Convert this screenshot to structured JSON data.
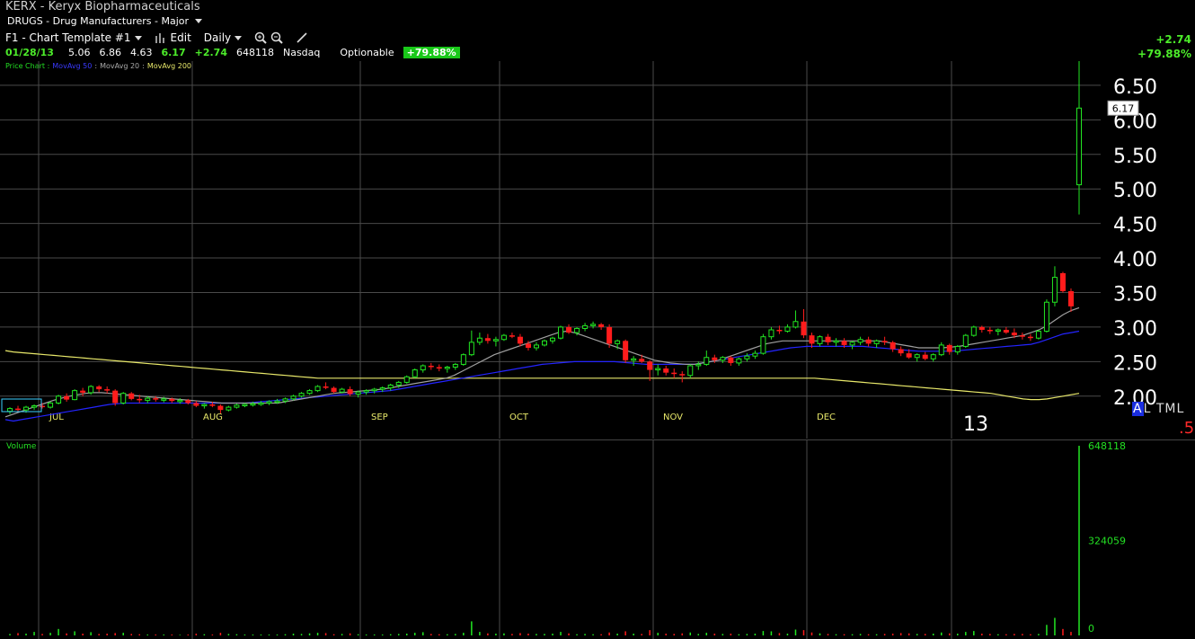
{
  "header": {
    "title": "KERX - Keryx Biopharmaceuticals",
    "industry": "DRUGS - Drug Manufacturers - Major"
  },
  "toolbar": {
    "template": "F1 - Chart Template #1",
    "edit": "Edit",
    "interval": "Daily"
  },
  "quote": {
    "date": "01/28/13",
    "open": "5.06",
    "high": "6.86",
    "low": "4.63",
    "close": "6.17",
    "change": "+2.74",
    "volume": "648118",
    "exchange": "Nasdaq",
    "optionable": "Optionable",
    "pct_change": "+79.88%"
  },
  "right_info": {
    "change": "+2.74",
    "pct": "+79.88%"
  },
  "legend": {
    "price": "Price Chart :",
    "ma50": "MovAvg 50",
    "ma20": "MovAvg 20",
    "ma200": "MovAvg 200",
    "sep": ":"
  },
  "last_price_tag": "6.17",
  "year_label": "13",
  "scale_modes": {
    "a": "A",
    "l": "L",
    "t": "T",
    "m": "M",
    "l2": "L"
  },
  "scale_fraction": ".5",
  "volume_panel": {
    "label": "Volume",
    "ticks": [
      "648118",
      "324059",
      "0"
    ]
  },
  "colors": {
    "up": "#22e622",
    "down": "#ff1c1c",
    "ma50": "#2424ff",
    "ma20": "#a0a0a0",
    "ma200": "#e8e86a",
    "grid": "#4a4a4a"
  },
  "chart_data": {
    "type": "candlestick",
    "ylim": [
      1.75,
      6.85
    ],
    "y_ticks": [
      "6.50",
      "6.00",
      "5.50",
      "5.00",
      "4.50",
      "4.00",
      "3.50",
      "3.00",
      "2.50",
      "2.00"
    ],
    "month_labels": [
      "JUL",
      "AUG",
      "SEP",
      "OCT",
      "NOV",
      "DEC"
    ],
    "candles": [
      [
        1.78,
        1.84,
        1.74,
        1.82
      ],
      [
        1.82,
        1.86,
        1.78,
        1.8
      ],
      [
        1.8,
        1.86,
        1.76,
        1.84
      ],
      [
        1.84,
        1.88,
        1.8,
        1.86
      ],
      [
        1.86,
        1.9,
        1.82,
        1.84
      ],
      [
        1.84,
        1.92,
        1.82,
        1.9
      ],
      [
        1.9,
        2.02,
        1.88,
        2.0
      ],
      [
        2.0,
        2.04,
        1.92,
        1.95
      ],
      [
        1.95,
        2.1,
        1.94,
        2.08
      ],
      [
        2.08,
        2.12,
        2.0,
        2.05
      ],
      [
        2.05,
        2.16,
        2.02,
        2.14
      ],
      [
        2.14,
        2.16,
        2.06,
        2.1
      ],
      [
        2.1,
        2.14,
        2.04,
        2.08
      ],
      [
        2.08,
        2.1,
        1.86,
        1.9
      ],
      [
        1.9,
        2.06,
        1.88,
        2.04
      ],
      [
        2.04,
        2.06,
        1.94,
        1.96
      ],
      [
        1.96,
        2.02,
        1.9,
        1.94
      ],
      [
        1.94,
        2.0,
        1.9,
        1.97
      ],
      [
        1.97,
        2.0,
        1.92,
        1.95
      ],
      [
        1.95,
        1.99,
        1.91,
        1.96
      ],
      [
        1.96,
        1.98,
        1.9,
        1.93
      ],
      [
        1.93,
        1.97,
        1.89,
        1.94
      ],
      [
        1.94,
        1.96,
        1.88,
        1.9
      ],
      [
        1.9,
        1.93,
        1.84,
        1.86
      ],
      [
        1.86,
        1.9,
        1.82,
        1.88
      ],
      [
        1.88,
        1.92,
        1.84,
        1.86
      ],
      [
        1.86,
        1.88,
        1.75,
        1.8
      ],
      [
        1.8,
        1.86,
        1.78,
        1.84
      ],
      [
        1.84,
        1.89,
        1.82,
        1.87
      ],
      [
        1.87,
        1.9,
        1.84,
        1.88
      ],
      [
        1.88,
        1.92,
        1.85,
        1.89
      ],
      [
        1.89,
        1.93,
        1.86,
        1.9
      ],
      [
        1.9,
        1.94,
        1.87,
        1.92
      ],
      [
        1.92,
        1.96,
        1.89,
        1.93
      ],
      [
        1.93,
        1.98,
        1.9,
        1.96
      ],
      [
        1.96,
        2.02,
        1.94,
        2.0
      ],
      [
        2.0,
        2.06,
        1.98,
        2.04
      ],
      [
        2.04,
        2.1,
        2.02,
        2.08
      ],
      [
        2.08,
        2.16,
        2.06,
        2.14
      ],
      [
        2.14,
        2.2,
        2.1,
        2.12
      ],
      [
        2.12,
        2.14,
        2.04,
        2.06
      ],
      [
        2.06,
        2.12,
        2.04,
        2.1
      ],
      [
        2.1,
        2.14,
        2.0,
        2.03
      ],
      [
        2.03,
        2.08,
        1.98,
        2.06
      ],
      [
        2.06,
        2.1,
        2.02,
        2.08
      ],
      [
        2.08,
        2.12,
        2.04,
        2.1
      ],
      [
        2.1,
        2.14,
        2.06,
        2.12
      ],
      [
        2.12,
        2.18,
        2.08,
        2.16
      ],
      [
        2.16,
        2.22,
        2.12,
        2.2
      ],
      [
        2.2,
        2.3,
        2.18,
        2.28
      ],
      [
        2.28,
        2.4,
        2.26,
        2.38
      ],
      [
        2.38,
        2.46,
        2.34,
        2.44
      ],
      [
        2.44,
        2.48,
        2.38,
        2.42
      ],
      [
        2.42,
        2.46,
        2.36,
        2.4
      ],
      [
        2.4,
        2.44,
        2.34,
        2.42
      ],
      [
        2.42,
        2.48,
        2.38,
        2.46
      ],
      [
        2.46,
        2.62,
        2.44,
        2.6
      ],
      [
        2.6,
        2.95,
        2.58,
        2.78
      ],
      [
        2.78,
        2.92,
        2.74,
        2.84
      ],
      [
        2.84,
        2.9,
        2.76,
        2.8
      ],
      [
        2.8,
        2.86,
        2.72,
        2.82
      ],
      [
        2.82,
        2.9,
        2.8,
        2.88
      ],
      [
        2.88,
        2.92,
        2.84,
        2.86
      ],
      [
        2.86,
        2.9,
        2.72,
        2.76
      ],
      [
        2.76,
        2.8,
        2.66,
        2.7
      ],
      [
        2.7,
        2.78,
        2.66,
        2.74
      ],
      [
        2.74,
        2.82,
        2.72,
        2.8
      ],
      [
        2.8,
        2.86,
        2.76,
        2.84
      ],
      [
        2.84,
        3.02,
        2.82,
        3.0
      ],
      [
        3.0,
        3.04,
        2.9,
        2.92
      ],
      [
        2.92,
        3.0,
        2.88,
        2.98
      ],
      [
        2.98,
        3.06,
        2.94,
        3.02
      ],
      [
        3.02,
        3.08,
        2.98,
        3.04
      ],
      [
        3.04,
        3.06,
        2.96,
        3.0
      ],
      [
        3.0,
        3.04,
        2.7,
        2.76
      ],
      [
        2.76,
        2.82,
        2.68,
        2.8
      ],
      [
        2.8,
        2.82,
        2.48,
        2.52
      ],
      [
        2.52,
        2.58,
        2.44,
        2.54
      ],
      [
        2.54,
        2.6,
        2.48,
        2.5
      ],
      [
        2.5,
        2.52,
        2.22,
        2.38
      ],
      [
        2.38,
        2.46,
        2.3,
        2.4
      ],
      [
        2.4,
        2.44,
        2.3,
        2.34
      ],
      [
        2.34,
        2.4,
        2.26,
        2.32
      ],
      [
        2.32,
        2.36,
        2.2,
        2.3
      ],
      [
        2.3,
        2.46,
        2.26,
        2.44
      ],
      [
        2.44,
        2.5,
        2.38,
        2.46
      ],
      [
        2.46,
        2.66,
        2.44,
        2.56
      ],
      [
        2.56,
        2.6,
        2.48,
        2.52
      ],
      [
        2.52,
        2.58,
        2.48,
        2.56
      ],
      [
        2.56,
        2.58,
        2.44,
        2.48
      ],
      [
        2.48,
        2.56,
        2.44,
        2.54
      ],
      [
        2.54,
        2.62,
        2.5,
        2.58
      ],
      [
        2.58,
        2.66,
        2.54,
        2.62
      ],
      [
        2.62,
        2.9,
        2.6,
        2.86
      ],
      [
        2.86,
        3.0,
        2.82,
        2.96
      ],
      [
        2.96,
        3.02,
        2.9,
        2.94
      ],
      [
        2.94,
        3.04,
        2.92,
        3.0
      ],
      [
        3.0,
        3.24,
        2.98,
        3.08
      ],
      [
        3.08,
        3.26,
        2.84,
        2.88
      ],
      [
        2.88,
        2.92,
        2.7,
        2.76
      ],
      [
        2.76,
        2.88,
        2.72,
        2.86
      ],
      [
        2.86,
        2.9,
        2.74,
        2.78
      ],
      [
        2.78,
        2.84,
        2.72,
        2.8
      ],
      [
        2.8,
        2.84,
        2.7,
        2.74
      ],
      [
        2.74,
        2.8,
        2.68,
        2.78
      ],
      [
        2.78,
        2.86,
        2.74,
        2.82
      ],
      [
        2.82,
        2.86,
        2.72,
        2.76
      ],
      [
        2.76,
        2.82,
        2.7,
        2.8
      ],
      [
        2.8,
        2.86,
        2.74,
        2.78
      ],
      [
        2.78,
        2.8,
        2.64,
        2.68
      ],
      [
        2.68,
        2.72,
        2.58,
        2.62
      ],
      [
        2.62,
        2.68,
        2.54,
        2.56
      ],
      [
        2.56,
        2.62,
        2.5,
        2.6
      ],
      [
        2.6,
        2.64,
        2.52,
        2.54
      ],
      [
        2.54,
        2.62,
        2.5,
        2.6
      ],
      [
        2.6,
        2.78,
        2.58,
        2.74
      ],
      [
        2.74,
        2.76,
        2.6,
        2.64
      ],
      [
        2.64,
        2.74,
        2.6,
        2.72
      ],
      [
        2.72,
        2.9,
        2.7,
        2.88
      ],
      [
        2.88,
        3.02,
        2.86,
        3.0
      ],
      [
        3.0,
        3.02,
        2.92,
        2.96
      ],
      [
        2.96,
        3.0,
        2.9,
        2.94
      ],
      [
        2.94,
        2.98,
        2.88,
        2.96
      ],
      [
        2.96,
        3.0,
        2.9,
        2.92
      ],
      [
        2.92,
        2.98,
        2.84,
        2.88
      ],
      [
        2.88,
        2.92,
        2.82,
        2.86
      ],
      [
        2.86,
        2.9,
        2.8,
        2.84
      ],
      [
        2.84,
        2.96,
        2.82,
        2.94
      ],
      [
        2.94,
        3.4,
        2.92,
        3.36
      ],
      [
        3.36,
        3.88,
        3.3,
        3.72
      ],
      [
        3.78,
        3.8,
        3.5,
        3.52
      ],
      [
        3.52,
        3.56,
        3.22,
        3.3
      ],
      [
        5.06,
        6.86,
        4.63,
        6.17
      ]
    ],
    "volume": [
      5000,
      8000,
      6000,
      12000,
      5000,
      9000,
      22000,
      7000,
      14000,
      6000,
      11000,
      5000,
      6000,
      8000,
      9000,
      5000,
      4000,
      3000,
      3000,
      3000,
      3000,
      2000,
      3000,
      6000,
      4000,
      3000,
      9000,
      5000,
      4000,
      3000,
      3000,
      3000,
      3000,
      3000,
      4000,
      6000,
      5000,
      7000,
      9000,
      8000,
      4000,
      5000,
      7000,
      4000,
      3000,
      3000,
      3000,
      4000,
      5000,
      6000,
      9000,
      11000,
      5000,
      4000,
      4000,
      5000,
      9000,
      48000,
      12000,
      7000,
      6000,
      7000,
      5000,
      8000,
      6000,
      5000,
      5000,
      6000,
      12000,
      7000,
      4000,
      5000,
      4000,
      4000,
      10000,
      6000,
      14000,
      6000,
      5000,
      18000,
      9000,
      6000,
      5000,
      7000,
      10000,
      5000,
      9000,
      6000,
      5000,
      6000,
      4000,
      5000,
      6000,
      15000,
      14000,
      8000,
      6000,
      20000,
      18000,
      10000,
      7000,
      5000,
      4000,
      4000,
      4000,
      5000,
      4000,
      4000,
      5000,
      6000,
      8000,
      7000,
      5000,
      5000,
      6000,
      10000,
      7000,
      6000,
      12000,
      15000,
      6000,
      5000,
      4000,
      4000,
      5000,
      5000,
      4000,
      5000,
      36000,
      60000,
      22000,
      12000,
      648118
    ],
    "volume_max": 648118,
    "ma50": [
      1.66,
      1.64,
      1.66,
      1.68,
      1.7,
      1.72,
      1.74,
      1.76,
      1.78,
      1.8,
      1.82,
      1.84,
      1.86,
      1.88,
      1.89,
      1.9,
      1.9,
      1.9,
      1.9,
      1.9,
      1.9,
      1.9,
      1.9,
      1.9,
      1.9,
      1.9,
      1.9,
      1.9,
      1.9,
      1.9,
      1.9,
      1.91,
      1.92,
      1.93,
      1.94,
      1.95,
      1.96,
      1.97,
      1.98,
      1.99,
      2.0,
      2.01,
      2.02,
      2.03,
      2.04,
      2.05,
      2.06,
      2.07,
      2.08,
      2.1,
      2.12,
      2.14,
      2.16,
      2.18,
      2.2,
      2.22,
      2.24,
      2.26,
      2.28,
      2.3,
      2.32,
      2.34,
      2.36,
      2.38,
      2.4,
      2.42,
      2.44,
      2.46,
      2.47,
      2.48,
      2.49,
      2.5,
      2.5,
      2.5,
      2.5,
      2.5,
      2.5,
      2.49,
      2.48,
      2.47,
      2.46,
      2.46,
      2.46,
      2.46,
      2.46,
      2.46,
      2.46,
      2.48,
      2.5,
      2.52,
      2.54,
      2.56,
      2.58,
      2.6,
      2.62,
      2.64,
      2.66,
      2.68,
      2.7,
      2.71,
      2.72,
      2.72,
      2.72,
      2.72,
      2.72,
      2.72,
      2.72,
      2.72,
      2.71,
      2.7,
      2.69,
      2.68,
      2.67,
      2.66,
      2.65,
      2.65,
      2.65,
      2.65,
      2.65,
      2.66,
      2.67,
      2.68,
      2.69,
      2.7,
      2.71,
      2.72,
      2.73,
      2.74,
      2.75,
      2.78,
      2.82,
      2.86,
      2.9,
      2.92,
      2.94
    ],
    "ma20": [
      1.7,
      1.74,
      1.78,
      1.82,
      1.86,
      1.9,
      1.94,
      1.97,
      2.0,
      2.02,
      2.04,
      2.05,
      2.05,
      2.04,
      2.03,
      2.02,
      2.01,
      2.0,
      1.99,
      1.98,
      1.97,
      1.96,
      1.95,
      1.94,
      1.93,
      1.92,
      1.91,
      1.9,
      1.9,
      1.9,
      1.9,
      1.9,
      1.9,
      1.9,
      1.9,
      1.92,
      1.94,
      1.96,
      1.98,
      2.0,
      2.02,
      2.04,
      2.05,
      2.06,
      2.07,
      2.08,
      2.09,
      2.1,
      2.12,
      2.14,
      2.16,
      2.18,
      2.2,
      2.22,
      2.24,
      2.26,
      2.3,
      2.36,
      2.42,
      2.48,
      2.54,
      2.6,
      2.64,
      2.68,
      2.72,
      2.76,
      2.8,
      2.84,
      2.88,
      2.92,
      2.94,
      2.92,
      2.88,
      2.84,
      2.8,
      2.76,
      2.72,
      2.68,
      2.64,
      2.6,
      2.56,
      2.52,
      2.5,
      2.48,
      2.47,
      2.46,
      2.46,
      2.48,
      2.5,
      2.52,
      2.56,
      2.6,
      2.64,
      2.68,
      2.72,
      2.76,
      2.78,
      2.8,
      2.8,
      2.8,
      2.8,
      2.8,
      2.8,
      2.8,
      2.8,
      2.8,
      2.8,
      2.8,
      2.8,
      2.8,
      2.78,
      2.76,
      2.74,
      2.72,
      2.7,
      2.7,
      2.7,
      2.7,
      2.71,
      2.72,
      2.74,
      2.76,
      2.78,
      2.8,
      2.82,
      2.84,
      2.86,
      2.88,
      2.92,
      2.96,
      3.02,
      3.1,
      3.18,
      3.24,
      3.28
    ],
    "ma200": [
      2.66,
      2.64,
      2.63,
      2.62,
      2.61,
      2.6,
      2.59,
      2.58,
      2.57,
      2.56,
      2.55,
      2.54,
      2.53,
      2.52,
      2.51,
      2.5,
      2.49,
      2.48,
      2.47,
      2.46,
      2.45,
      2.44,
      2.43,
      2.42,
      2.41,
      2.4,
      2.39,
      2.38,
      2.37,
      2.36,
      2.35,
      2.34,
      2.33,
      2.32,
      2.31,
      2.3,
      2.29,
      2.28,
      2.27,
      2.26,
      2.26,
      2.26,
      2.26,
      2.26,
      2.26,
      2.26,
      2.26,
      2.26,
      2.26,
      2.26,
      2.26,
      2.26,
      2.26,
      2.26,
      2.26,
      2.26,
      2.26,
      2.26,
      2.26,
      2.26,
      2.26,
      2.26,
      2.26,
      2.26,
      2.26,
      2.26,
      2.26,
      2.26,
      2.26,
      2.26,
      2.26,
      2.26,
      2.26,
      2.26,
      2.26,
      2.26,
      2.26,
      2.26,
      2.26,
      2.26,
      2.26,
      2.26,
      2.26,
      2.26,
      2.26,
      2.26,
      2.26,
      2.26,
      2.26,
      2.26,
      2.26,
      2.26,
      2.26,
      2.26,
      2.26,
      2.26,
      2.26,
      2.26,
      2.26,
      2.26,
      2.26,
      2.26,
      2.25,
      2.24,
      2.23,
      2.22,
      2.21,
      2.2,
      2.19,
      2.18,
      2.17,
      2.16,
      2.15,
      2.14,
      2.13,
      2.12,
      2.11,
      2.1,
      2.09,
      2.08,
      2.07,
      2.06,
      2.05,
      2.04,
      2.02,
      2.0,
      1.98,
      1.96,
      1.95,
      1.95,
      1.96,
      1.98,
      2.0,
      2.02,
      2.04
    ]
  }
}
